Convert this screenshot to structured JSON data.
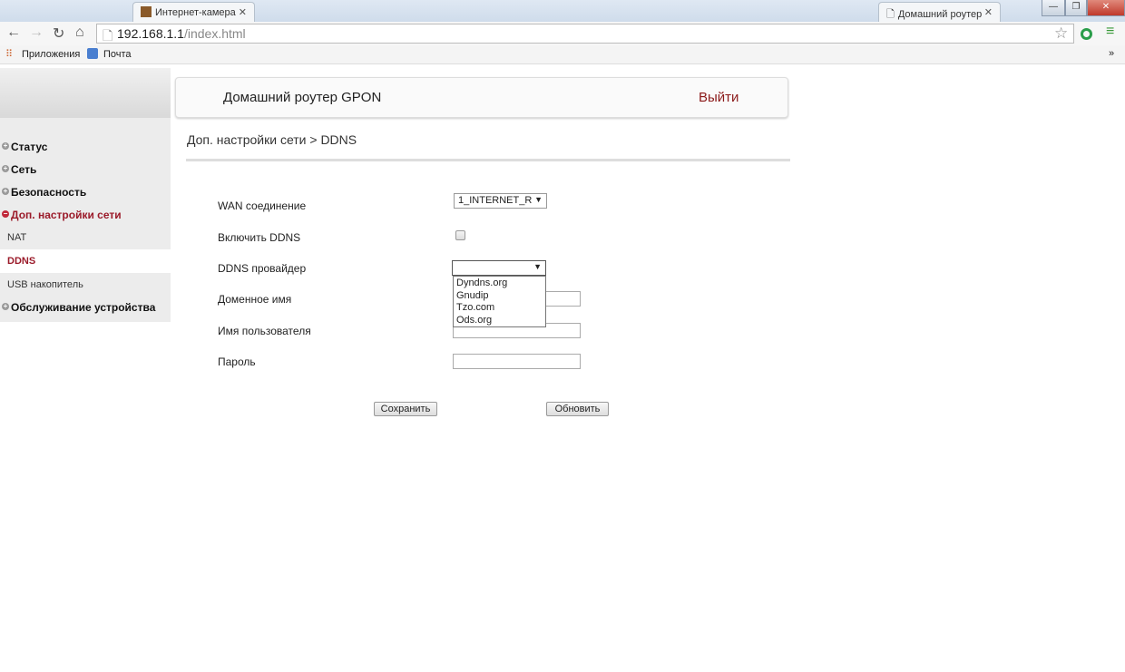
{
  "browser": {
    "tabs": [
      {
        "label": "Интернет-камера"
      },
      {
        "label": "Домашний роутер"
      }
    ],
    "url_host": "192.168.1.1",
    "url_path": "/index.html",
    "bookmarks": [
      "Приложения",
      "Почта"
    ],
    "more": "»"
  },
  "header": {
    "title": "Домашний роутер GPON",
    "logout": "Выйти"
  },
  "sidebar": {
    "items": [
      {
        "label": "Статус",
        "type": "menu"
      },
      {
        "label": "Сеть",
        "type": "menu"
      },
      {
        "label": "Безопасность",
        "type": "menu"
      },
      {
        "label": "Доп. настройки сети",
        "type": "menu",
        "active": true
      },
      {
        "label": "NAT",
        "type": "sub"
      },
      {
        "label": "DDNS",
        "type": "sub",
        "selected": true
      },
      {
        "label": "USB накопитель",
        "type": "sub"
      },
      {
        "label": "Обслуживание устройства",
        "type": "menu"
      }
    ]
  },
  "breadcrumb": "Доп. настройки сети > DDNS",
  "form": {
    "wan_label": "WAN соединение",
    "wan_value": "1_INTERNET_R",
    "enable_label": "Включить DDNS",
    "enable_checked": false,
    "provider_label": "DDNS провайдер",
    "provider_value": "",
    "provider_options": [
      "Dyndns.org",
      "Gnudip",
      "Tzo.com",
      "Ods.org"
    ],
    "domain_label": "Доменное имя",
    "domain_value": "",
    "user_label": "Имя пользователя",
    "user_value": "",
    "password_label": "Пароль",
    "password_value": "",
    "save": "Сохранить",
    "refresh": "Обновить"
  },
  "colors": {
    "accent": "#9b1b2a",
    "logout": "#8b1a1a"
  }
}
